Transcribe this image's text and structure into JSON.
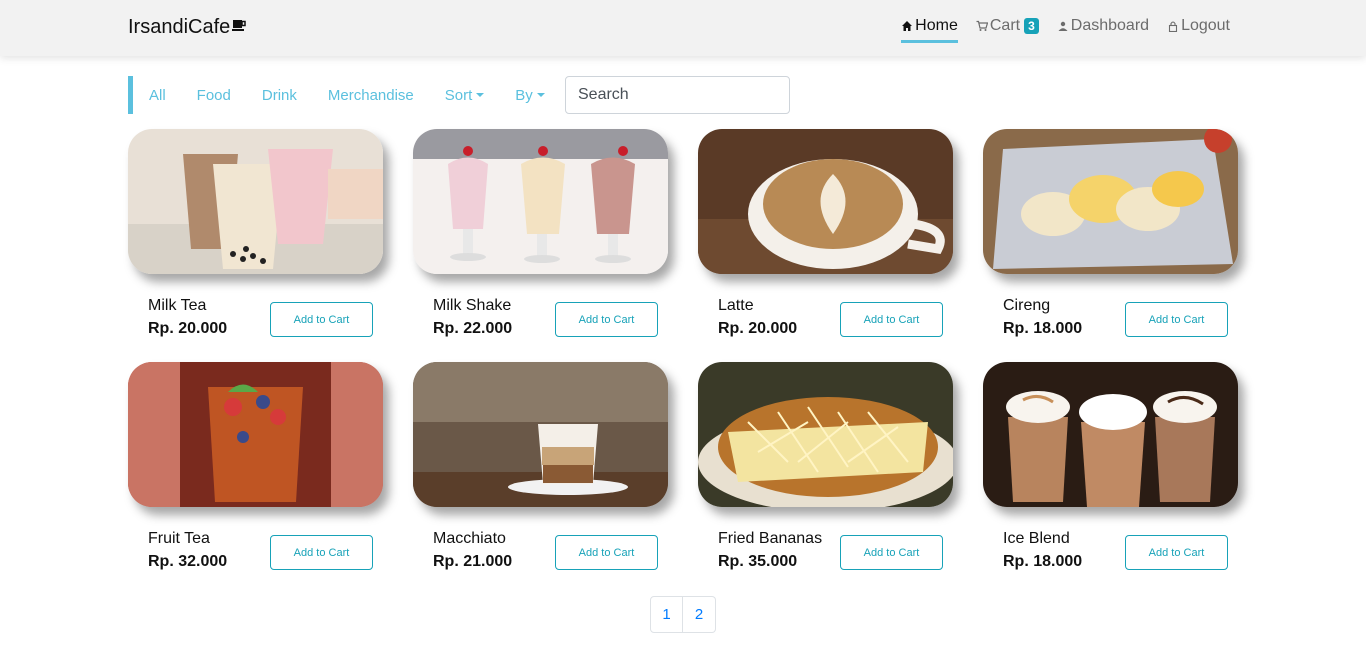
{
  "brand": {
    "name": "IrsandiCafe",
    "icon": "coffee-cup-icon"
  },
  "nav": {
    "home": "Home",
    "cart": "Cart",
    "cart_count": "3",
    "dashboard": "Dashboard",
    "logout": "Logout"
  },
  "filters": {
    "all": "All",
    "food": "Food",
    "drink": "Drink",
    "merchandise": "Merchandise",
    "sort": "Sort",
    "by": "By",
    "search_placeholder": "Search"
  },
  "products": [
    {
      "name": "Milk Tea",
      "price": "Rp. 20.000",
      "button": "Add to Cart"
    },
    {
      "name": "Milk Shake",
      "price": "Rp. 22.000",
      "button": "Add to Cart"
    },
    {
      "name": "Latte",
      "price": "Rp. 20.000",
      "button": "Add to Cart"
    },
    {
      "name": "Cireng",
      "price": "Rp. 18.000",
      "button": "Add to Cart"
    },
    {
      "name": "Fruit Tea",
      "price": "Rp. 32.000",
      "button": "Add to Cart"
    },
    {
      "name": "Macchiato",
      "price": "Rp. 21.000",
      "button": "Add to Cart"
    },
    {
      "name": "Fried Bananas",
      "price": "Rp. 35.000",
      "button": "Add to Cart"
    },
    {
      "name": "Ice Blend",
      "price": "Rp. 18.000",
      "button": "Add to Cart"
    }
  ],
  "pagination": [
    "1",
    "2"
  ],
  "colors": {
    "accent": "#5bc0de",
    "button": "#17a2b8",
    "page_link": "#007bff"
  }
}
